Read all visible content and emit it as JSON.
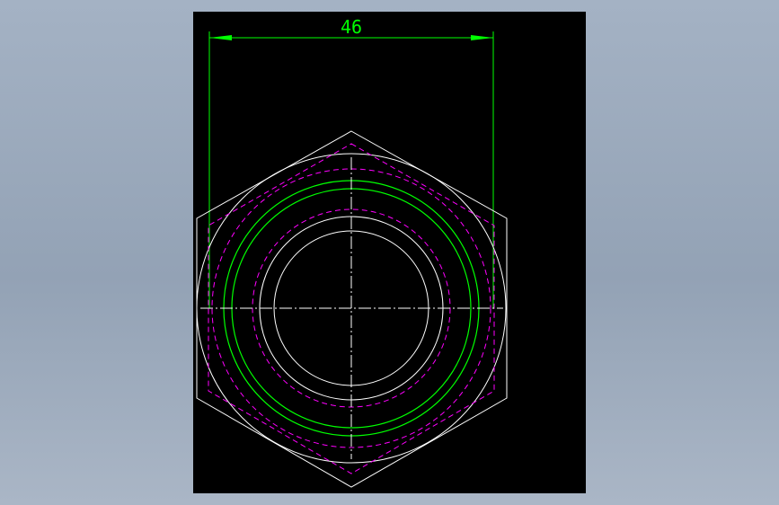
{
  "drawing": {
    "dimension_value": "46",
    "colors": {
      "background": "#000000",
      "outline": "#ffffff",
      "dimension": "#00ff00",
      "hidden": "#ff00ff",
      "thread": "#00ff00"
    }
  }
}
